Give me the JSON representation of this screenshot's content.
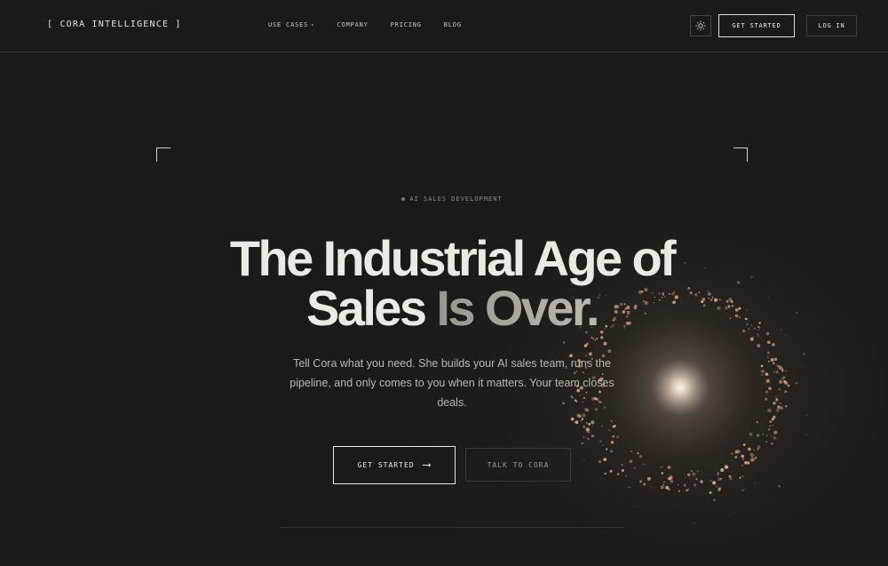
{
  "brand": "[ CORA INTELLIGENCE ]",
  "nav": {
    "links": [
      {
        "label": "USE CASES",
        "has_dropdown": true
      },
      {
        "label": "COMPANY"
      },
      {
        "label": "PRICING"
      },
      {
        "label": "BLOG"
      }
    ],
    "theme_icon": "sun-icon",
    "get_started": "GET STARTED",
    "log_in": "LOG IN"
  },
  "hero": {
    "eyebrow": "AI SALES DEVELOPMENT",
    "headline_line1": "The Industrial Age of",
    "headline_line2_a": "Sales ",
    "headline_line2_b": "Is Over.",
    "subtitle": "Tell Cora what you need. She builds your AI sales team, runs the pipeline, and only comes to you when it matters. Your team closes deals.",
    "cta_primary": "GET STARTED",
    "cta_primary_icon": "arrow-right-icon",
    "cta_secondary": "TALK TO CORA"
  },
  "colors": {
    "background": "#1b1a18",
    "text": "#ece9e3",
    "muted": "#a8a39a",
    "orb_glow": "#f4e4d4",
    "orb_particles": "#d8a88c"
  }
}
